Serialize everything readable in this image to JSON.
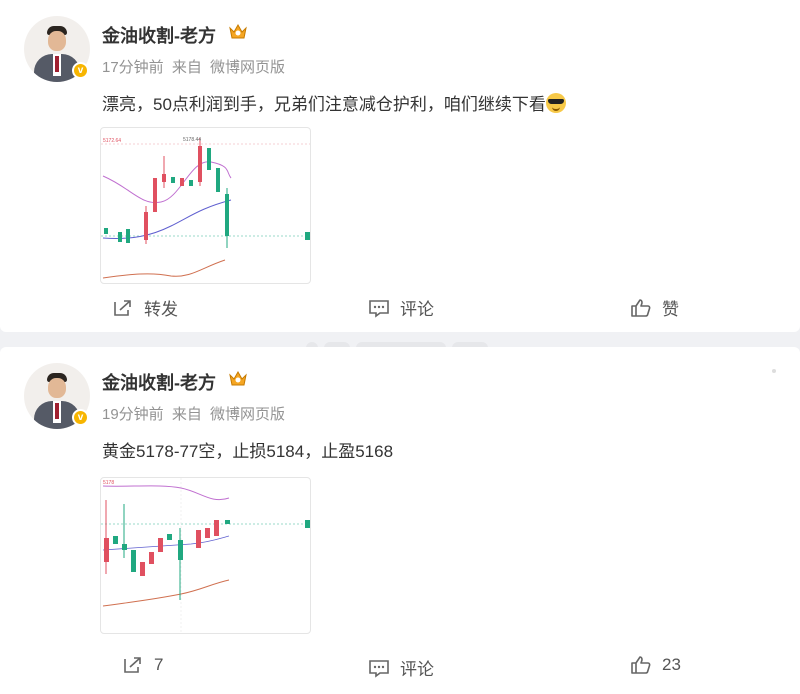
{
  "posts": [
    {
      "author": "金油收割-老方",
      "time": "17分钟前",
      "source_prefix": "来自",
      "source": "微博网页版",
      "text": "漂亮，50点利润到手，兄弟们注意减仓护利，咱们继续下看",
      "text_emoji": "cool-sunglasses-emoji",
      "chart_price_label": "5172.64",
      "chart_top_label": "5178.44",
      "actions": {
        "repost": "转发",
        "comment": "评论",
        "like": "赞"
      }
    },
    {
      "author": "金油收割-老方",
      "time": "19分钟前",
      "source_prefix": "来自",
      "source": "微博网页版",
      "text": "黄金5178-77空，止损5184，止盈5168",
      "chart_price_label": "5178",
      "actions": {
        "repost": "7",
        "comment": "评论",
        "like": "23"
      }
    }
  ],
  "icons": {
    "verified": "verified-badge-icon",
    "crown": "crown-badge-icon",
    "repost": "share-icon",
    "comment": "comment-icon",
    "like": "thumbs-up-icon"
  },
  "colors": {
    "up": "#e05060",
    "down": "#20a880",
    "verified": "#f7b500"
  }
}
